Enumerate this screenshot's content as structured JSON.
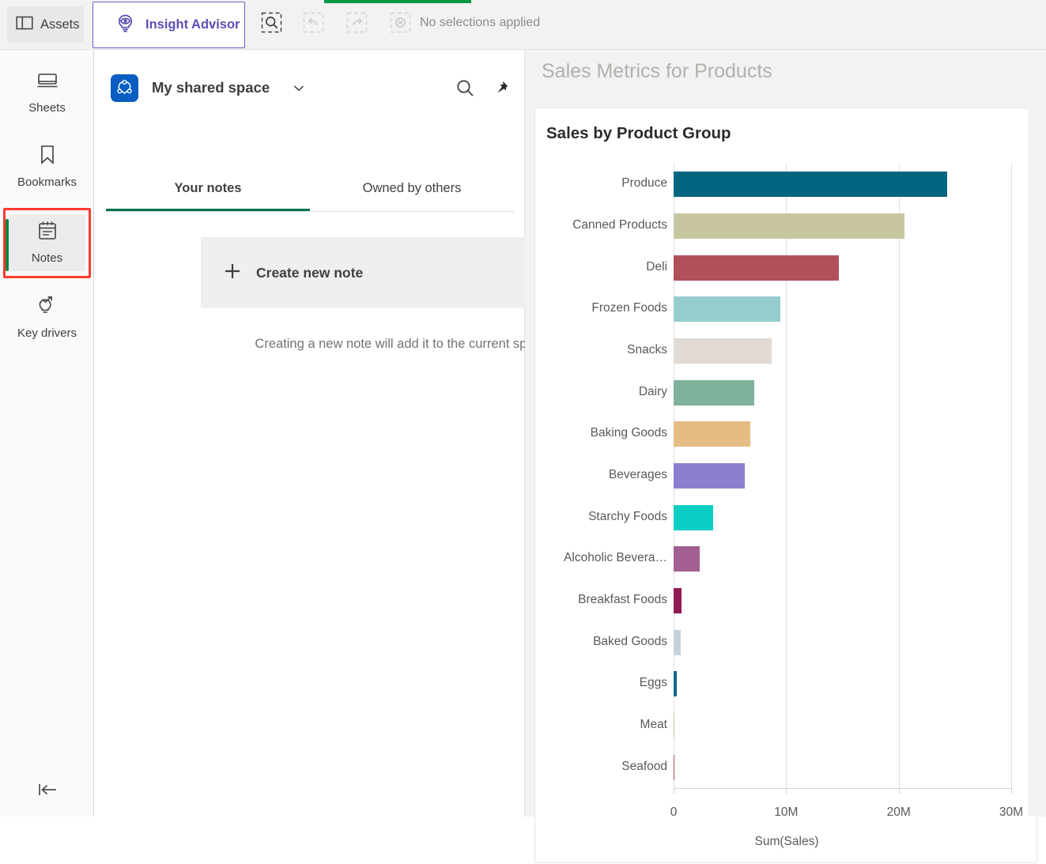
{
  "topbar": {
    "assets_label": "Assets",
    "assets_icon": "panel-layout-icon",
    "insight_advisor_label": "Insight Advisor",
    "insight_advisor_icon": "lightbulb-eye-icon",
    "smart_search_icon": "smart-search-icon",
    "back_icon": "undo-selection-icon",
    "forward_icon": "redo-selection-icon",
    "clear_icon": "clear-selections-icon",
    "selection_status": "No selections applied",
    "accent_color": "#009845",
    "tab_accent_color": "#6a5fc7"
  },
  "rail": {
    "items": [
      {
        "label": "Sheets",
        "icon": "sheets-icon",
        "active": false
      },
      {
        "label": "Bookmarks",
        "icon": "bookmark-icon",
        "active": false
      },
      {
        "label": "Notes",
        "icon": "notes-calendar-icon",
        "active": true
      },
      {
        "label": "Key drivers",
        "icon": "key-drivers-icon",
        "active": false
      }
    ],
    "collapse_icon": "collapse-left-icon",
    "highlight_color": "#ff3b30",
    "active_bar_color": "#00873d"
  },
  "notes": {
    "space_name": "My shared space",
    "space_icon": "shared-space-icon",
    "caret_icon": "chevron-down-icon",
    "search_icon": "search-icon",
    "pin_icon": "pin-icon",
    "tabs": [
      {
        "label": "Your notes",
        "active": true
      },
      {
        "label": "Owned by others",
        "active": false
      }
    ],
    "create_note_label": "Create new note",
    "create_note_icon": "plus-icon",
    "hint": "Creating a new note will add it to the current space."
  },
  "sheet": {
    "title": "Sales Metrics for Products"
  },
  "chart_data": {
    "type": "bar",
    "orientation": "horizontal",
    "title": "Sales by Product Group",
    "xlabel": "Sum(Sales)",
    "ylabel": "",
    "xlim": [
      0,
      30000000
    ],
    "xticks": [
      {
        "value": 0,
        "label": "0"
      },
      {
        "value": 10000000,
        "label": "10M"
      },
      {
        "value": 20000000,
        "label": "20M"
      },
      {
        "value": 30000000,
        "label": "30M"
      }
    ],
    "grid": true,
    "legend": "none",
    "categories": [
      "Produce",
      "Canned Products",
      "Deli",
      "Frozen Foods",
      "Snacks",
      "Dairy",
      "Baking Goods",
      "Beverages",
      "Starchy Foods",
      "Alcoholic Bevera…",
      "Breakfast Foods",
      "Baked Goods",
      "Eggs",
      "Meat",
      "Seafood"
    ],
    "values": [
      24300000,
      20500000,
      14700000,
      9500000,
      8700000,
      7200000,
      6800000,
      6350000,
      3500000,
      2300000,
      680000,
      660000,
      270000,
      70000,
      50000
    ],
    "colors": [
      "#006580",
      "#c8c6a0",
      "#b14f5a",
      "#95ccce",
      "#e2dad5",
      "#7fb19b",
      "#e5bd84",
      "#8c7fcd",
      "#0ccec4",
      "#a45f92",
      "#8f1a54",
      "#c6d2da",
      "#0b6a84",
      "#c8c6a0",
      "#b14f5a"
    ]
  }
}
